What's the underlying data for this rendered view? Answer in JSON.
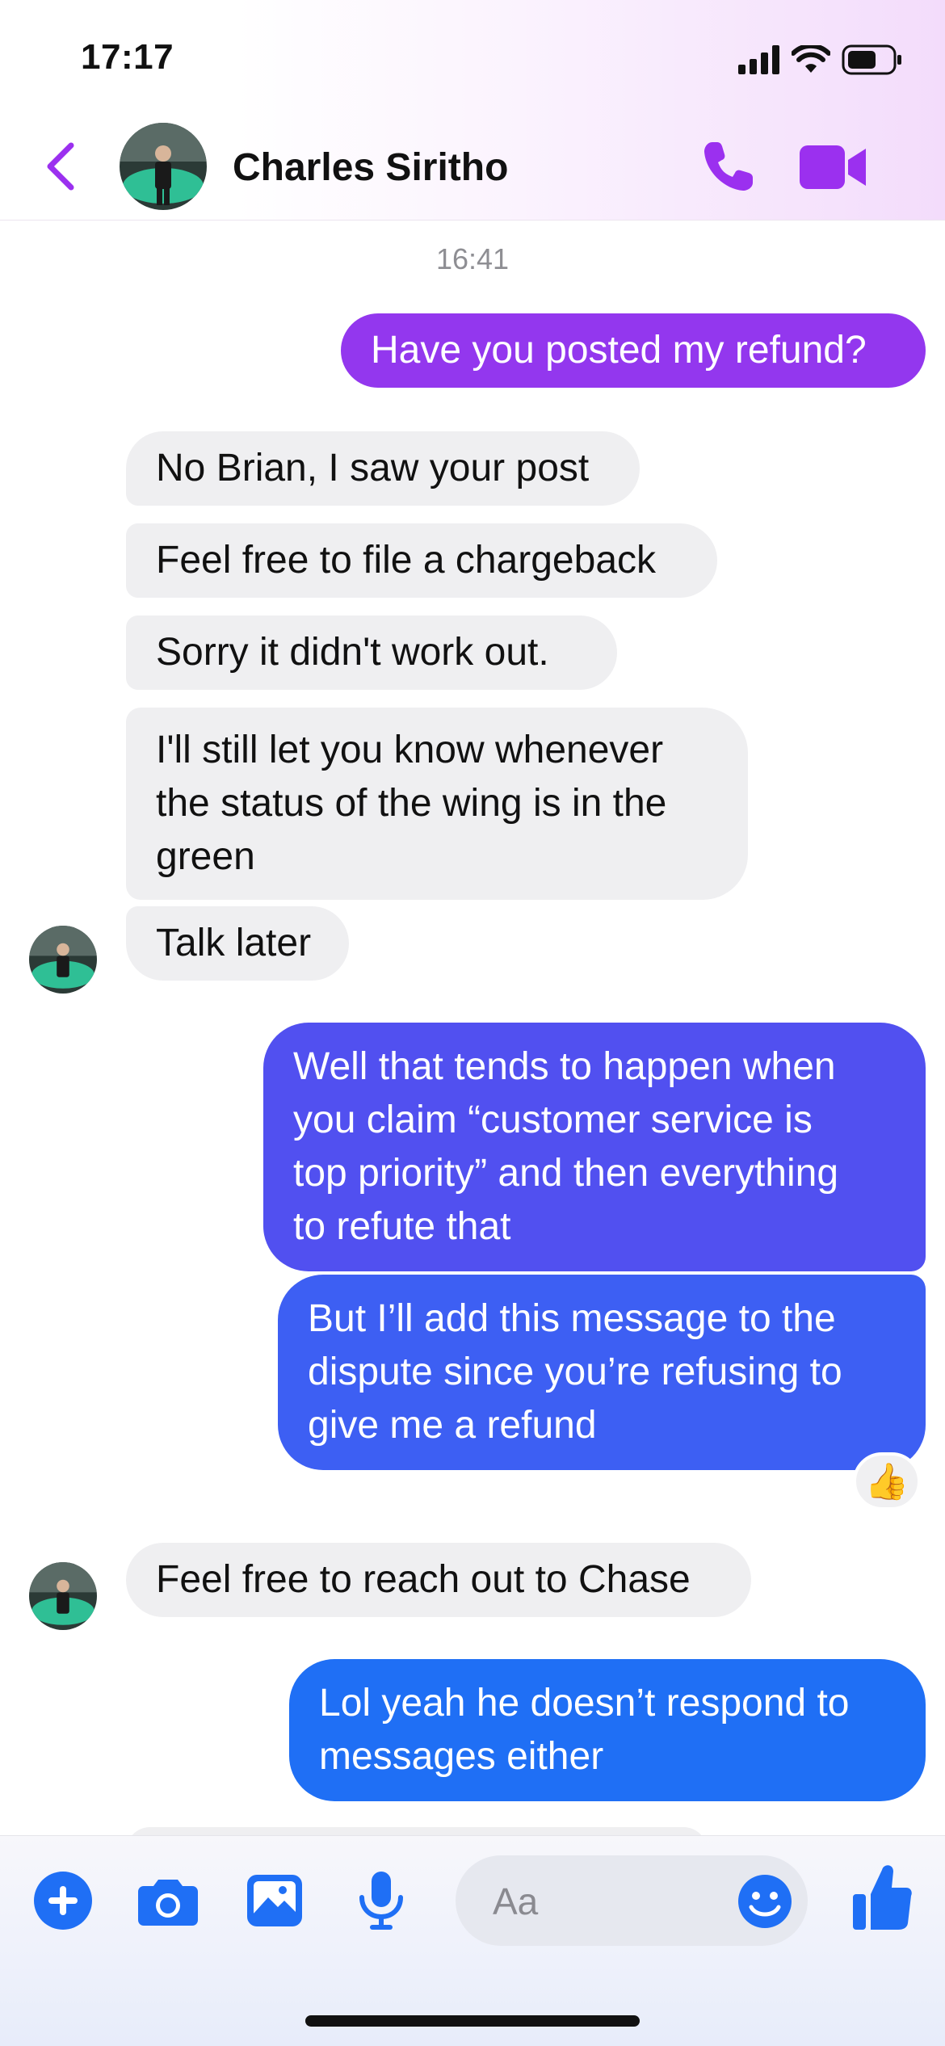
{
  "status_bar": {
    "time": "17:17"
  },
  "header": {
    "contact_name": "Charles Siritho"
  },
  "chat": {
    "timestamp": "16:41",
    "messages": [
      {
        "text": "Have you posted my refund?"
      },
      {
        "text": "No Brian, I saw your post"
      },
      {
        "text": "Feel free to file a chargeback"
      },
      {
        "text": "Sorry it didn't work out."
      },
      {
        "text": "I'll still let you know whenever\nthe status of the wing is in the\ngreen"
      },
      {
        "text": "Talk later"
      },
      {
        "text": "Well that tends to happen when\nyou claim “customer service is\ntop priority” and then everything\nto refute that"
      },
      {
        "text": "But I’ll add this message to the\ndispute since you’re refusing to\ngive me a refund",
        "reaction": "👍"
      },
      {
        "text": "Feel free to reach out to Chase"
      },
      {
        "text": "Lol yeah he doesn’t respond to\nmessages either"
      }
    ]
  },
  "composer": {
    "placeholder": "Aa"
  },
  "colors": {
    "accent_purple": "#9b30ef",
    "accent_blue": "#1f6ff5",
    "incoming_bubble": "#efeff1"
  }
}
